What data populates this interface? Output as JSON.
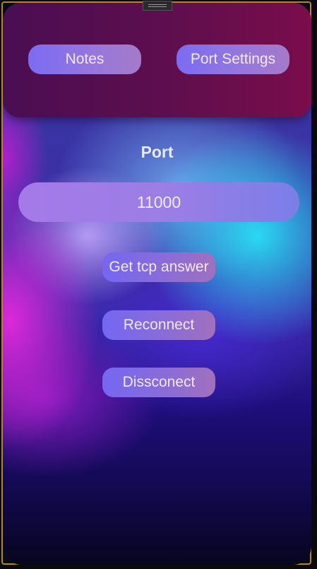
{
  "header": {
    "notes_label": "Notes",
    "port_settings_label": "Port Settings"
  },
  "port": {
    "label": "Port",
    "value": "11000"
  },
  "actions": {
    "get_tcp_answer_label": "Get tcp answer",
    "reconnect_label": "Reconnect",
    "disconnect_label": "Dissconect"
  },
  "colors": {
    "header_bg": "#5c0e4e",
    "frame_border": "#b08a1e",
    "button_gradient_start": "#7a6cf2",
    "button_gradient_end": "#a47ac8"
  }
}
